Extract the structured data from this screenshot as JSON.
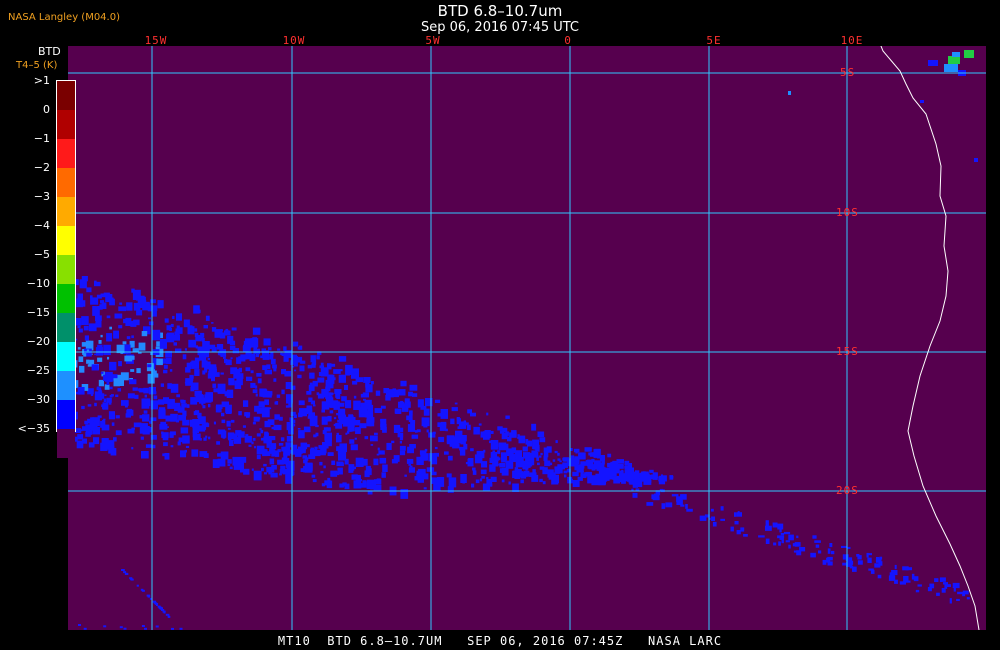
{
  "header": {
    "title": "BTD 6.8–10.7um",
    "datetime": "Sep 06, 2016 07:45 UTC",
    "producer": "NASA Langley (M04.0)"
  },
  "map": {
    "lon_labels": [
      "15W",
      "10W",
      "5W",
      "0",
      "5E",
      "10E"
    ],
    "lat_labels": [
      "5S",
      "10S",
      "15S",
      "20S"
    ],
    "background_color": "#56004e",
    "grid_color": "#30c8ff",
    "coast_color": "#ffffff",
    "cloud_color": "#1414ff",
    "cloud_light_color": "#2288ff"
  },
  "colorbar": {
    "title": "BTD",
    "subtitle": "T4–5 (K)",
    "ticks": [
      ">1",
      "0",
      "−1",
      "−2",
      "−3",
      "−4",
      "−5",
      "−10",
      "−15",
      "−20",
      "−25",
      "−30",
      "<−35"
    ],
    "colors": [
      "#7a0000",
      "#b00000",
      "#ff1a1a",
      "#ff6a00",
      "#ffaa00",
      "#ffff00",
      "#88e000",
      "#00c000",
      "#00906a",
      "#00ffff",
      "#1e90ff",
      "#0000ff",
      "#56004e"
    ]
  },
  "footer": {
    "text": "MT10  BTD 6.8–10.7UM   SEP 06, 2016 07:45Z   NASA LARC"
  }
}
